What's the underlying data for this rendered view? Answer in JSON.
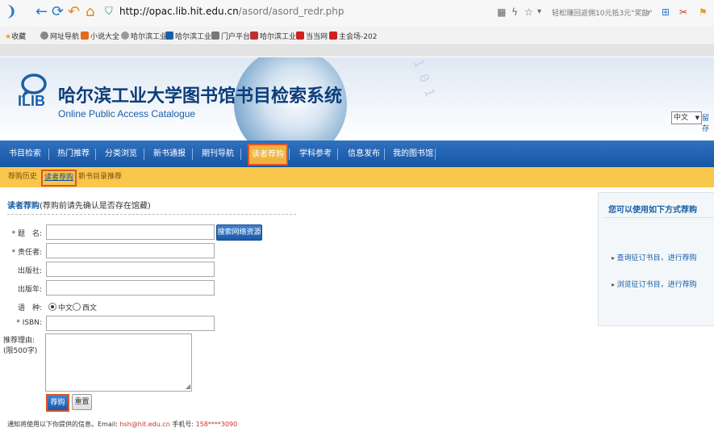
{
  "browser": {
    "url_host": "http://opac.lib.hit.edu.cn",
    "url_path": "/asord/asord_redr.php",
    "promo_text": "轻松赚回返佣10元抵3元\"奖励\"",
    "favorites_label": "收藏",
    "favorites": [
      "网址导航",
      "小说大全",
      "哈尔滨工业",
      "哈尔滨工业",
      "门户平台",
      "哈尔滨工业",
      "当当网",
      "主会场-202"
    ]
  },
  "header": {
    "logo_text": "ILIB",
    "title": "哈尔滨工业大学图书馆书目检索系统",
    "subtitle": "Online Public Access Catalogue",
    "deco_binary": "0 1 0 0 1 0 1",
    "lang_selected": "中文",
    "lang_more": "留存"
  },
  "main_nav": [
    "书目检索",
    "热门推荐",
    "分类浏览",
    "新书通报",
    "期刊导航",
    "读者荐购",
    "学科参考",
    "信息发布",
    "我的图书馆"
  ],
  "main_nav_active": 5,
  "sub_nav": [
    "荐购历史",
    "读者荐购",
    "新书目录推荐"
  ],
  "sub_nav_active": 1,
  "form": {
    "section_title": "读者荐购",
    "section_note": "(荐购前请先确认是否存在馆藏)",
    "labels": {
      "title": "* 题　名:",
      "author": "* 责任者:",
      "publisher": "出版社:",
      "year": "出版年:",
      "language": "语　种:",
      "isbn": "* ISBN:",
      "reason": "推荐理由:",
      "reason_limit": "(限500字)"
    },
    "search_button": "搜索网络资源",
    "language_options": [
      "中文",
      "西文"
    ],
    "language_selected": "中文",
    "submit_button": "荐购",
    "reset_button": "重置",
    "notice_prefix": "通知将使用以下你提供的信息。Email:",
    "notice_email": "hsh@hit.edu.cn",
    "notice_phone_label": "手机号:",
    "notice_phone": "158****3090"
  },
  "right_panel": {
    "title": "您可以使用如下方式荐购",
    "items": [
      "查询征订书目，进行荐购",
      "浏览征订书目，进行荐购"
    ]
  },
  "colors": {
    "nav_blue": "#1a5fa8",
    "subnav_yellow": "#f8c64a",
    "highlight_border": "#e0552a"
  }
}
